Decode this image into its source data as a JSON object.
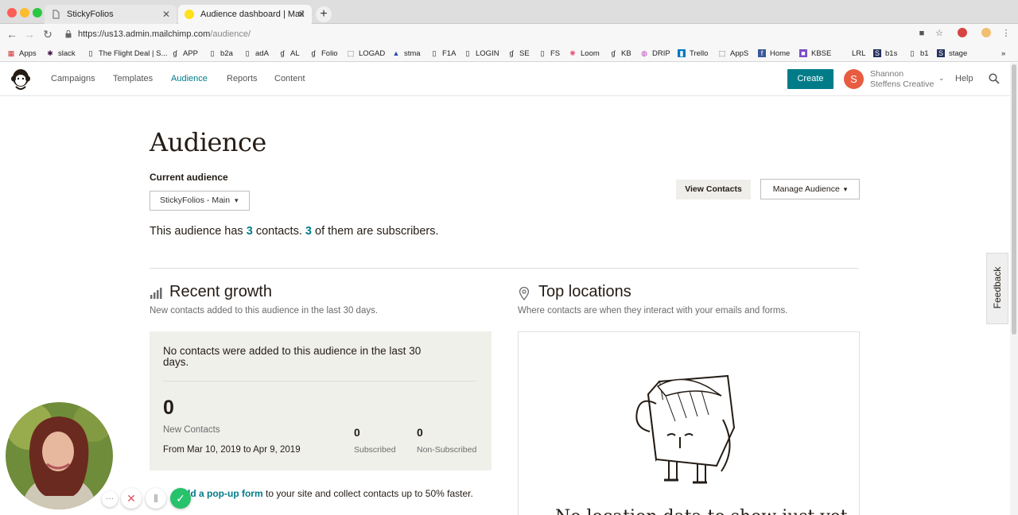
{
  "browser": {
    "tabs": [
      {
        "title": "StickyFolios",
        "active": false
      },
      {
        "title": "Audience dashboard | Mailchim",
        "active": true
      }
    ],
    "url_main": "https://us13.admin.mailchimp.com",
    "url_path": "/audience/",
    "bookmarks": [
      "Apps",
      "slack",
      "The Flight Deal | S...",
      "APP",
      "b2a",
      "adA",
      "AL",
      "Folio",
      "LOGAD",
      "stma",
      "F1A",
      "LOGIN",
      "SE",
      "FS",
      "Loom",
      "KB",
      "DRIP",
      "Trello",
      "AppS",
      "Home",
      "KBSE",
      "LRL",
      "b1s",
      "b1",
      "stage"
    ],
    "overflow": "»"
  },
  "header": {
    "nav": [
      "Campaigns",
      "Templates",
      "Audience",
      "Reports",
      "Content"
    ],
    "active_nav": "Audience",
    "create_label": "Create",
    "avatar_initial": "S",
    "user_name": "Shannon",
    "user_org": "Steffens Creative",
    "help_label": "Help"
  },
  "main": {
    "title": "Audience",
    "current_label": "Current audience",
    "audience_selected": "StickyFolios - Main",
    "view_contacts": "View Contacts",
    "manage_audience": "Manage Audience",
    "summary_pre": "This audience has",
    "contacts_count": "3",
    "summary_mid": "contacts.",
    "subscribers_count": "3",
    "summary_post": "of them are subscribers."
  },
  "growth": {
    "title": "Recent growth",
    "subtitle": "New contacts added to this audience in the last 30 days.",
    "message": "No contacts were added to this audience in the last 30 days.",
    "new_contacts": "0",
    "new_contacts_label": "New Contacts",
    "date_range": "From Mar 10, 2019 to Apr 9, 2019",
    "subscribed": "0",
    "subscribed_label": "Subscribed",
    "non_subscribed": "0",
    "non_subscribed_label": "Non-Subscribed",
    "popup_link": "dd a pop-up form",
    "popup_text": "to your site and collect contacts up to 50% faster."
  },
  "locations": {
    "title": "Top locations",
    "subtitle": "Where contacts are when they interact with your emails and forms.",
    "no_data": "No location data to show just yet"
  },
  "feedback_label": "Feedback",
  "colors": {
    "accent": "#007c89",
    "avatar": "#e85c41",
    "card_bg": "#f0f0eb"
  },
  "recorder_controls": [
    "more-icon",
    "stop-icon",
    "pause-icon",
    "check-icon"
  ]
}
